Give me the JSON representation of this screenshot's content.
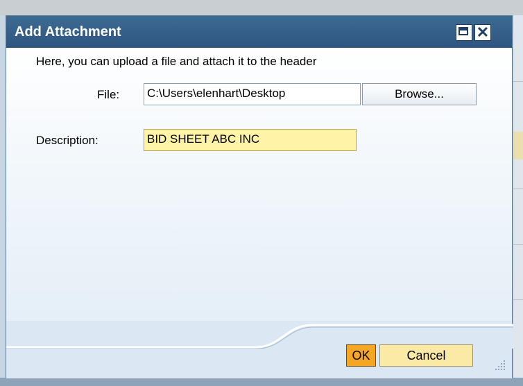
{
  "dialog": {
    "title": "Add Attachment",
    "intro_text": "Here, you can upload a file and attach it to the header",
    "file_label": "File:",
    "file_value": "C:\\Users\\elenhart\\Desktop",
    "browse_label": "Browse...",
    "description_label": "Description:",
    "description_value": "BID SHEET ABC INC",
    "ok_label": "OK",
    "cancel_label": "Cancel",
    "maximize_icon": "maximize-icon",
    "close_icon": "close-icon"
  },
  "colors": {
    "titlebar": "#2d5580",
    "ok_button": "#f5a623",
    "cancel_button": "#fbe9a6",
    "description_field": "#fff3a8"
  }
}
